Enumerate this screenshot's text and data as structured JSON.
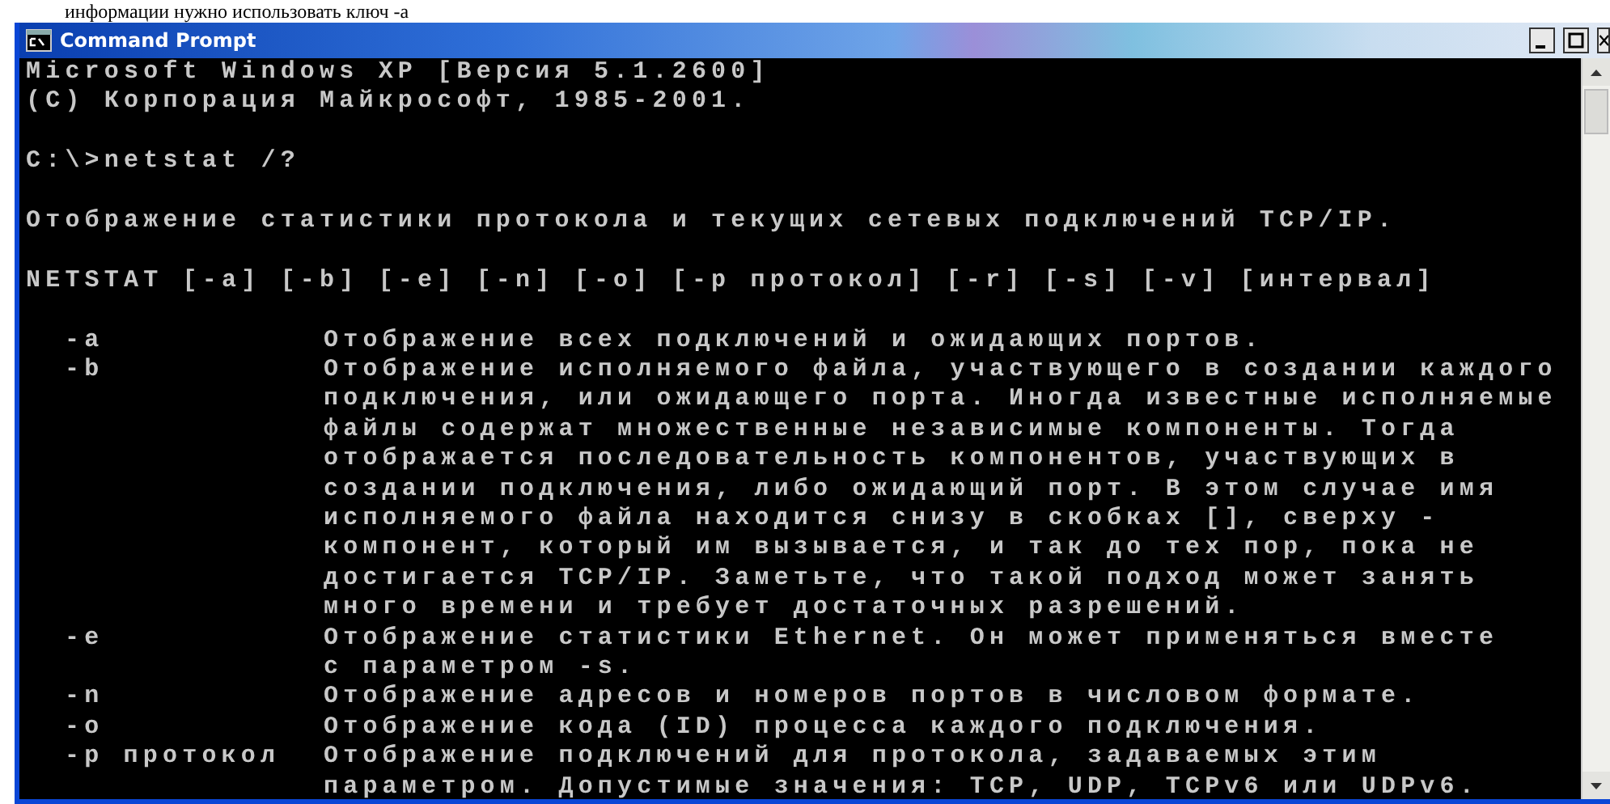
{
  "page_caption": "информации нужно использовать ключ -a",
  "window": {
    "title": "Command Prompt"
  },
  "console": {
    "blocks": [
      [
        "Microsoft Windows XP [Версия 5.1.2600]",
        "(C) Корпорация Майкрософт, 1985-2001."
      ],
      [
        "C:\\>netstat /?"
      ],
      [
        "Отображение статистики протокола и текущих сетевых подключений TCP/IP."
      ],
      [
        "NETSTAT [-a] [-b] [-e] [-n] [-o] [-p протокол] [-r] [-s] [-v] [интервал]"
      ]
    ],
    "options": [
      {
        "flag": "-a",
        "lines": [
          "Отображение всех подключений и ожидающих портов."
        ]
      },
      {
        "flag": "-b",
        "lines": [
          "Отображение исполняемого файла, участвующего в создании каждого",
          "подключения, или ожидающего порта. Иногда известные исполняемые",
          "файлы содержат множественные независимые компоненты. Тогда",
          "отображается последовательность компонентов, участвующих в",
          "создании подключения, либо ожидающий порт. В этом случае имя",
          "исполняемого файла находится снизу в скобках [], сверху -",
          "компонент, который им вызывается, и так до тех пор, пока не",
          "достигается TCP/IP. Заметьте, что такой подход может занять",
          "много времени и требует достаточных разрешений."
        ]
      },
      {
        "flag": "-e",
        "lines": [
          "Отображение статистики Ethernet. Он может применяться вместе",
          "с параметром -s."
        ]
      },
      {
        "flag": "-n",
        "lines": [
          "Отображение адресов и номеров портов в числовом формате."
        ]
      },
      {
        "flag": "-o",
        "lines": [
          "Отображение кода (ID) процесса каждого подключения."
        ]
      },
      {
        "flag": "-p протокол",
        "lines": [
          "Отображение подключений для протокола, задаваемых этим",
          "параметром. Допустимые значения: TCP, UDP, TCPv6 или UDPv6."
        ]
      }
    ]
  }
}
